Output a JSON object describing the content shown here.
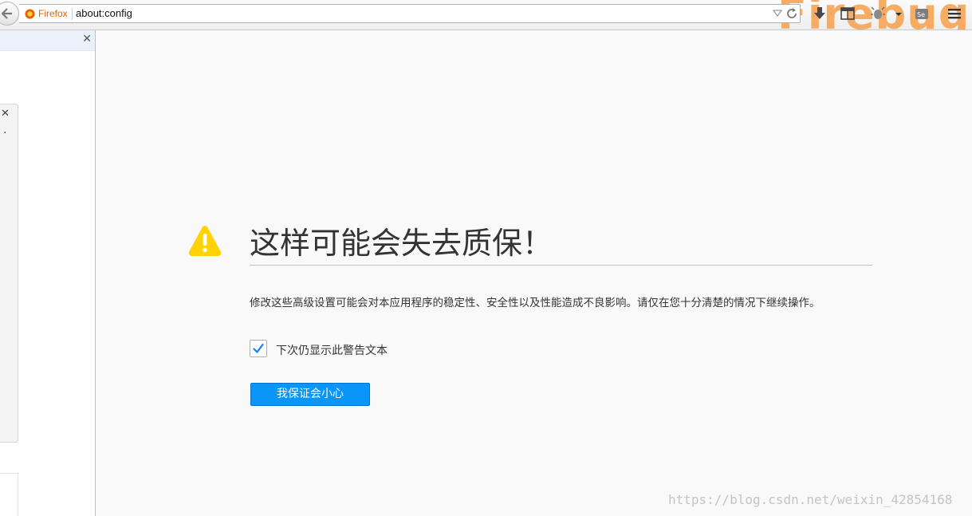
{
  "toolbar": {
    "identity_label": "Firefox",
    "url": "about:config",
    "theme_word": "Firebug"
  },
  "warning": {
    "title": "这样可能会失去质保！",
    "description": "修改这些高级设置可能会对本应用程序的稳定性、安全性以及性能造成不良影响。请仅在您十分清楚的情况下继续操作。",
    "checkbox_label": "下次仍显示此警告文本",
    "checkbox_checked": true,
    "button_label": "我保证会小心"
  },
  "watermark": "https://blog.csdn.net/weixin_42854168",
  "colors": {
    "accent_button": "#0996f8",
    "warning_icon": "#ffd200",
    "identity": "#e66000"
  }
}
